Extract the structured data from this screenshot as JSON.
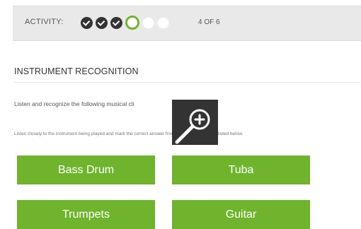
{
  "activity": {
    "label": "ACTIVITY:",
    "steps": [
      "done",
      "done",
      "done",
      "current",
      "todo",
      "todo"
    ],
    "progress_text": "4 OF 6",
    "current_step": 4,
    "total_steps": 6
  },
  "section": {
    "title": "INSTRUMENT RECOGNITION"
  },
  "question": {
    "prompt": "Listen and recognize the following musical cli",
    "instructions": "Listen closely to the instrument being played and mark the correct answer from the four instruments listed below."
  },
  "answers": [
    "Bass Drum",
    "Tuba",
    "Trumpets",
    "Guitar"
  ],
  "icons": {
    "step_done": "check-circle-icon",
    "step_current": "ring-icon",
    "step_todo": "empty-circle-icon",
    "zoom": "zoom-in-icon"
  },
  "colors": {
    "accent": "#6fb42c",
    "activity_bar": "#e9e9e9",
    "zoom_overlay": "#333333"
  }
}
